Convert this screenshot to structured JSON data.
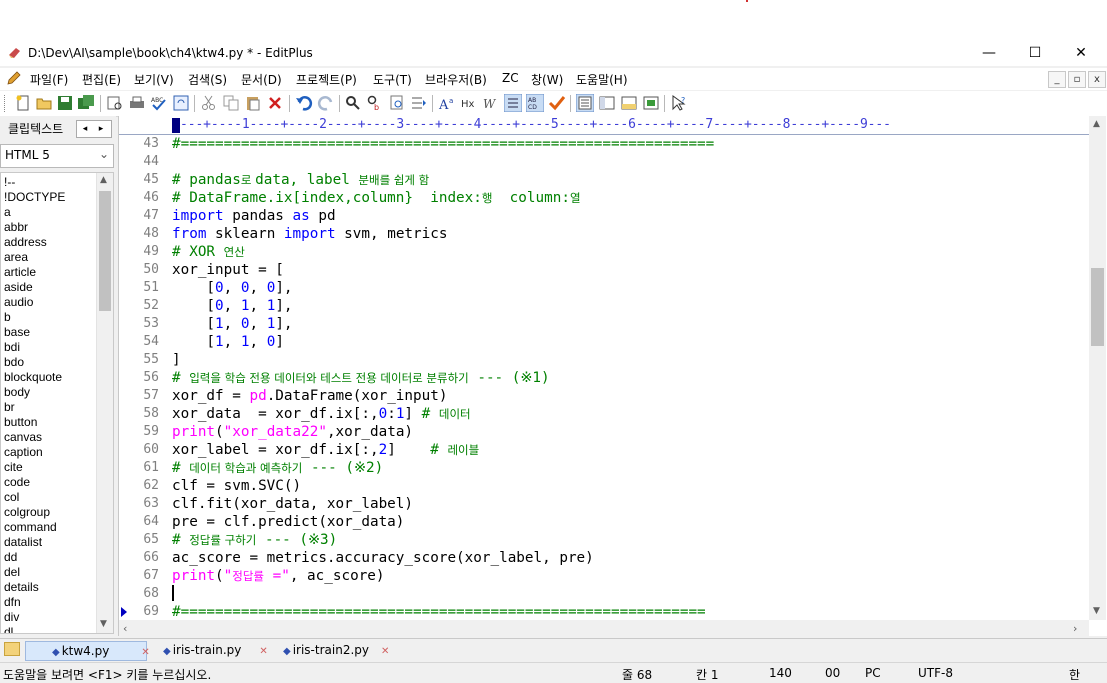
{
  "window": {
    "title": "D:\\Dev\\AI\\sample\\book\\ch4\\ktw4.py * - EditPlus",
    "minimize": "—",
    "maximize": "☐",
    "close": "✕"
  },
  "menu": {
    "items": [
      "파일(F)",
      "편집(E)",
      "보기(V)",
      "검색(S)",
      "문서(D)",
      "프로젝트(P)",
      "도구(T)",
      "브라우저(B)",
      "ZC",
      "창(W)",
      "도움말(H)"
    ],
    "mdi": [
      "_",
      "▫",
      "x"
    ]
  },
  "toolbar": {
    "icons": [
      "new-file-icon",
      "open-folder-icon",
      "save-icon",
      "save-all-icon",
      "print-preview-icon",
      "print-icon",
      "spellcheck-icon",
      "browser-preview-icon",
      "cut-icon",
      "copy-icon",
      "paste-icon",
      "delete-icon",
      "undo-icon",
      "redo-icon",
      "find-icon",
      "replace-icon",
      "find-in-files-icon",
      "goto-line-icon",
      "font-size-icon",
      "heading-icon",
      "word-wrap-icon",
      "line-numbers-icon",
      "column-select-icon",
      "check-icon",
      "toggle-cliptext-icon",
      "toggle-directory-icon",
      "toggle-output-icon",
      "full-screen-icon",
      "help-icon"
    ]
  },
  "cliptext": {
    "title": "클립텍스트",
    "prev": "◂",
    "next": "▸",
    "library": "HTML 5",
    "items": [
      "!--",
      "!DOCTYPE",
      "a",
      "abbr",
      "address",
      "area",
      "article",
      "aside",
      "audio",
      "b",
      "base",
      "bdi",
      "bdo",
      "blockquote",
      "body",
      "br",
      "button",
      "canvas",
      "caption",
      "cite",
      "code",
      "col",
      "colgroup",
      "command",
      "datalist",
      "dd",
      "del",
      "details",
      "dfn",
      "div",
      "dl"
    ]
  },
  "editor": {
    "ruler": "---+----1----+----2----+----3----+----4----+----5----+----6----+----7----+----8----+----9---",
    "line_numbers": [
      "43",
      "44",
      "45",
      "46",
      "47",
      "48",
      "49",
      "50",
      "51",
      "52",
      "53",
      "54",
      "55",
      "56",
      "57",
      "58",
      "59",
      "60",
      "61",
      "62",
      "63",
      "64",
      "65",
      "66",
      "67",
      "68",
      "69"
    ],
    "sep_line": "#==============================================================",
    "l45_c": "# pandas",
    "l45_k": "로 ",
    "l45_c2": "data, label ",
    "l45_k2": "분배를 쉽게 함",
    "l46_c": "# DataFrame.ix[index,column}  index:",
    "l46_k": "행",
    "l46_c2": "  column:",
    "l46_k2": "열",
    "l47_kw1": "import",
    "l47_a": " pandas ",
    "l47_kw2": "as",
    "l47_b": " pd",
    "l48_kw1": "from",
    "l48_a": " sklearn ",
    "l48_kw2": "import",
    "l48_b": " svm, metrics",
    "l49_c": "# XOR ",
    "l49_k": "연산",
    "l50": "xor_input = [",
    "l51_a": "    [",
    "l51_n1": "0",
    "l51_n2": "0",
    "l51_n3": "0",
    "l52_n1": "0",
    "l52_n2": "1",
    "l52_n3": "1",
    "l53_n1": "1",
    "l53_n2": "0",
    "l53_n3": "1",
    "l54_n1": "1",
    "l54_n2": "1",
    "l54_n3": "0",
    "l55": "]",
    "l56_c": "# ",
    "l56_k": "입력을 학습 전용 데이터와 테스트 전용 데이터로 분류하기",
    "l56_c2": " --- (※1)",
    "l57_a": "xor_df = ",
    "l57_fn": "pd",
    "l57_b": ".DataFrame(xor_input)",
    "l58_a": "xor_data  = xor_df.ix[:,",
    "l58_n1": "0",
    "l58_b": ":",
    "l58_n2": "1",
    "l58_c": "] ",
    "l58_cm": "# ",
    "l58_k": "데이터",
    "l59_kw": "print",
    "l59_a": "(",
    "l59_st": "\"xor_data22\"",
    "l59_b": ",xor_data)",
    "l60_a": "xor_label = xor_df.ix[:,",
    "l60_n": "2",
    "l60_b": "]    ",
    "l60_cm": "# ",
    "l60_k": "레이블",
    "l61_c": "# ",
    "l61_k": "데이터 학습과 예측하기",
    "l61_c2": " --- (※2)",
    "l62": "clf = svm.SVC()",
    "l63": "clf.fit(xor_data, xor_label)",
    "l64": "pre = clf.predict(xor_data)",
    "l65_c": "# ",
    "l65_k": "정답률 구하기",
    "l65_c2": " --- (※3)",
    "l66": "ac_score = metrics.accuracy_score(xor_label, pre)",
    "l67_kw": "print",
    "l67_a": "(",
    "l67_st1": "\"",
    "l67_k": "정답률",
    "l67_st2": " =\"",
    "l67_b": ", ac_score)",
    "sep_line2": "#============================================================="
  },
  "tabs": [
    {
      "name": "ktw4.py",
      "active": true
    },
    {
      "name": "iris-train.py",
      "active": false
    },
    {
      "name": "iris-train2.py",
      "active": false
    }
  ],
  "status": {
    "help": "도움말을 보려면 <F1> 키를 누르십시오.",
    "line": "줄 68",
    "col": "칸 1",
    "total": "140",
    "sel": "00",
    "fmt": "PC",
    "enc": "UTF-8",
    "ime": "한"
  }
}
